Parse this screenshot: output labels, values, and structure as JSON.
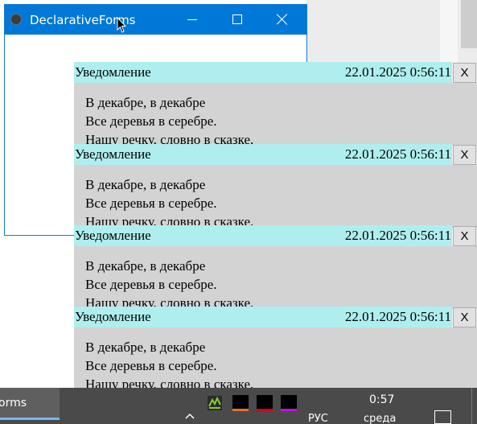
{
  "window": {
    "title": "DeclarativeForms",
    "icon": "globe-icon",
    "controls": {
      "minimize": "minimize-icon",
      "maximize": "maximize-icon",
      "close": "close-icon"
    }
  },
  "notifications": [
    {
      "title": "Уведомление",
      "timestamp": "22.01.2025 0:56:11",
      "close_label": "X",
      "lines": [
        "В декабре, в декабре",
        "Все деревья в серебре.",
        "Нашу речку, словно в сказке,"
      ]
    },
    {
      "title": "Уведомление",
      "timestamp": "22.01.2025 0:56:11",
      "close_label": "X",
      "lines": [
        "В декабре, в декабре",
        "Все деревья в серебре.",
        "Нашу речку, словно в сказке,"
      ]
    },
    {
      "title": "Уведомление",
      "timestamp": "22.01.2025 0:56:11",
      "close_label": "X",
      "lines": [
        "В декабре, в декабре",
        "Все деревья в серебре.",
        "Нашу речку, словно в сказке,"
      ]
    },
    {
      "title": "Уведомление",
      "timestamp": "22.01.2025 0:56:11",
      "close_label": "X",
      "lines": [
        "В декабре, в декабре",
        "Все деревья в серебре.",
        "Нашу речку, словно в сказке,"
      ]
    }
  ],
  "taskbar": {
    "app_label": "orms",
    "tray_icons": [
      "gpu-monitor-icon",
      "black-square-icon-orange",
      "black-square-icon-red",
      "black-square-icon-purple"
    ],
    "chevron": "chevron-up-icon",
    "language": "РУС",
    "time": "0:57",
    "day": "среда",
    "notification_icon": "action-center-icon"
  },
  "colors": {
    "titlebar": "#0078d7",
    "notif_header": "#afeeee",
    "notif_body": "#d3d3d3",
    "taskbar": "#4a4a4a",
    "accent_underline": "#76b9ed"
  }
}
